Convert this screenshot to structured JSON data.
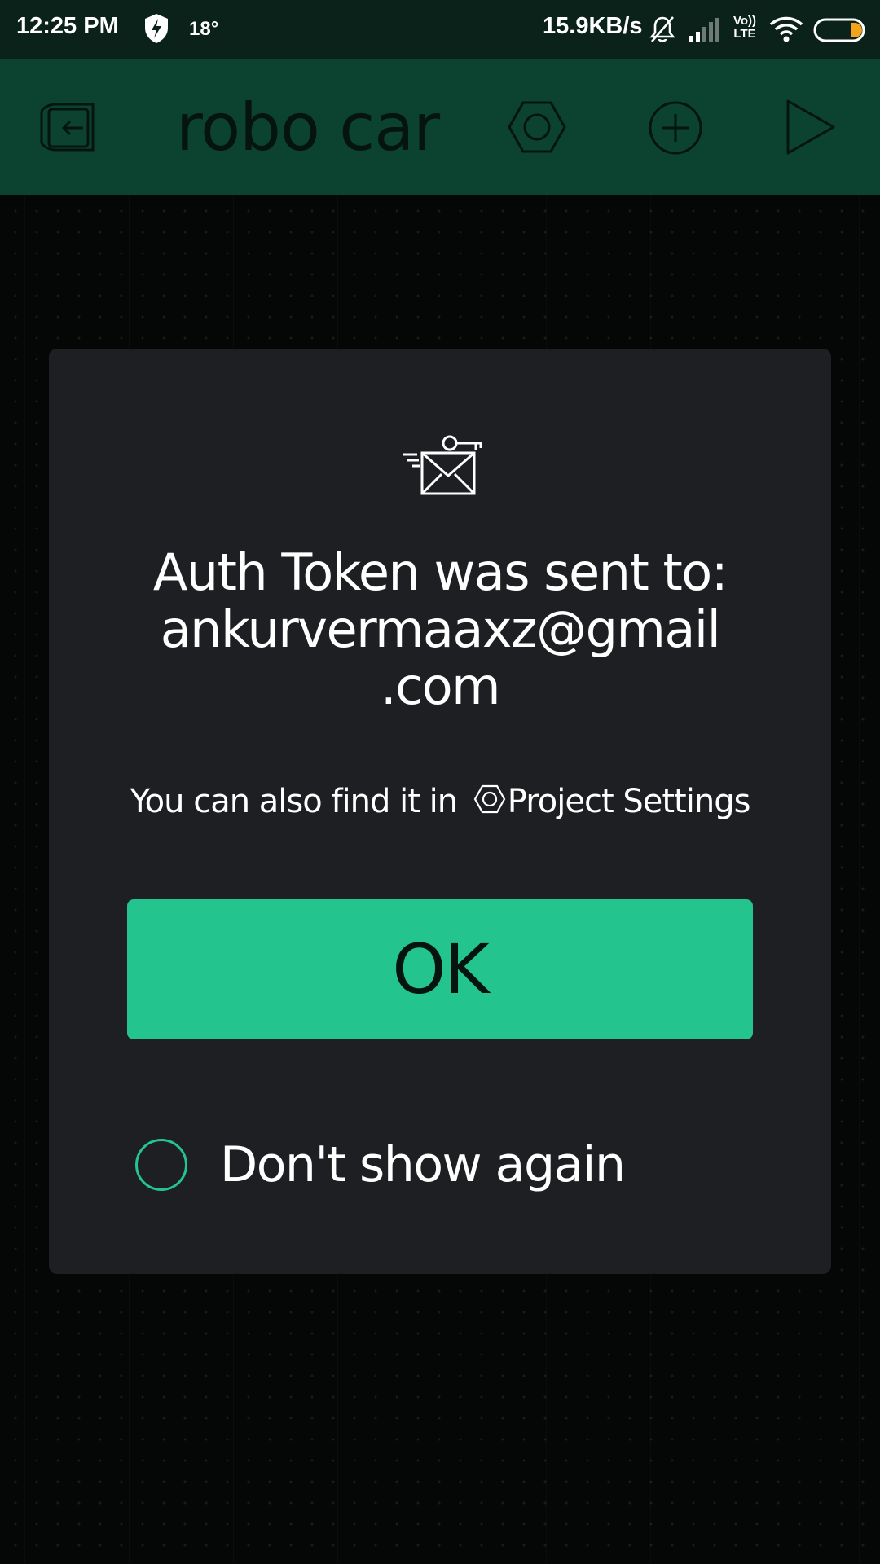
{
  "status_bar": {
    "time": "12:25 PM",
    "temperature": "18°",
    "network_speed": "15.9KB/s",
    "volte_label_top": "Vo))",
    "volte_label_bottom": "LTE",
    "battery_accent_color": "#f2a51c"
  },
  "toolbar": {
    "title": "robo car",
    "icons": [
      "exit-icon",
      "settings-hex-icon",
      "add-widget-icon",
      "play-icon"
    ]
  },
  "dialog": {
    "icon": "mail-key-icon",
    "title_line1": "Auth Token was sent to:",
    "title_line2": "ankurvermaaxz@gmail",
    "title_line3": ".com",
    "hint_prefix": "You can also find it in",
    "hint_link": "Project Settings",
    "ok_label": "OK",
    "dont_show_label": "Don't show again",
    "dont_show_checked": false
  },
  "colors": {
    "accent": "#23c48e",
    "toolbar": "#0b4330",
    "status_bar": "#0b221b",
    "dialog_bg": "#1e1f22",
    "background": "#050606"
  }
}
